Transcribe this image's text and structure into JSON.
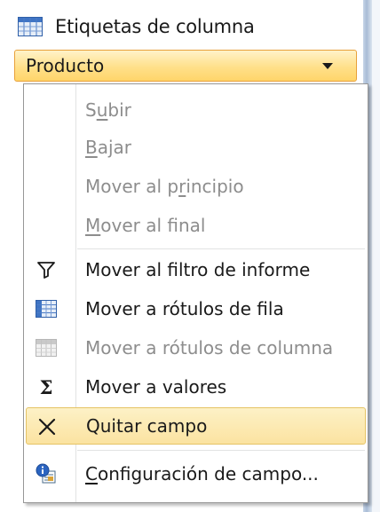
{
  "area": {
    "title": "Etiquetas de columna",
    "field_label": "Producto"
  },
  "menu": {
    "items": [
      {
        "pre": "S",
        "key": "u",
        "post": "bir",
        "disabled": true,
        "icon": ""
      },
      {
        "pre": "",
        "key": "B",
        "post": "ajar",
        "disabled": true,
        "icon": ""
      },
      {
        "pre": "Mover al p",
        "key": "r",
        "post": "incipio",
        "disabled": true,
        "icon": ""
      },
      {
        "pre": "",
        "key": "M",
        "post": "over al final",
        "disabled": true,
        "icon": ""
      },
      {
        "pre": "Mover al filtro de informe",
        "key": "",
        "post": "",
        "disabled": false,
        "icon": "filter-icon"
      },
      {
        "pre": "Mover a rótulos de fila",
        "key": "",
        "post": "",
        "disabled": false,
        "icon": "row-labels-grid-icon"
      },
      {
        "pre": "Mover a rótulos de columna",
        "key": "",
        "post": "",
        "disabled": true,
        "icon": "column-labels-grid-icon"
      },
      {
        "pre": "Mover a valores",
        "key": "",
        "post": "",
        "disabled": false,
        "icon": "sigma-icon"
      },
      {
        "pre": "Quitar campo",
        "key": "",
        "post": "",
        "disabled": false,
        "icon": "remove-x-icon",
        "highlighted": true
      },
      {
        "pre": "",
        "key": "C",
        "post": "onfiguración de campo...",
        "disabled": false,
        "icon": "field-settings-icon"
      }
    ],
    "sigma_glyph": "Σ",
    "x_glyph": "✕"
  },
  "colors": {
    "highlight_border": "#e5c365",
    "field_border": "#e8a13a",
    "disabled_text": "#8d8d8d"
  }
}
